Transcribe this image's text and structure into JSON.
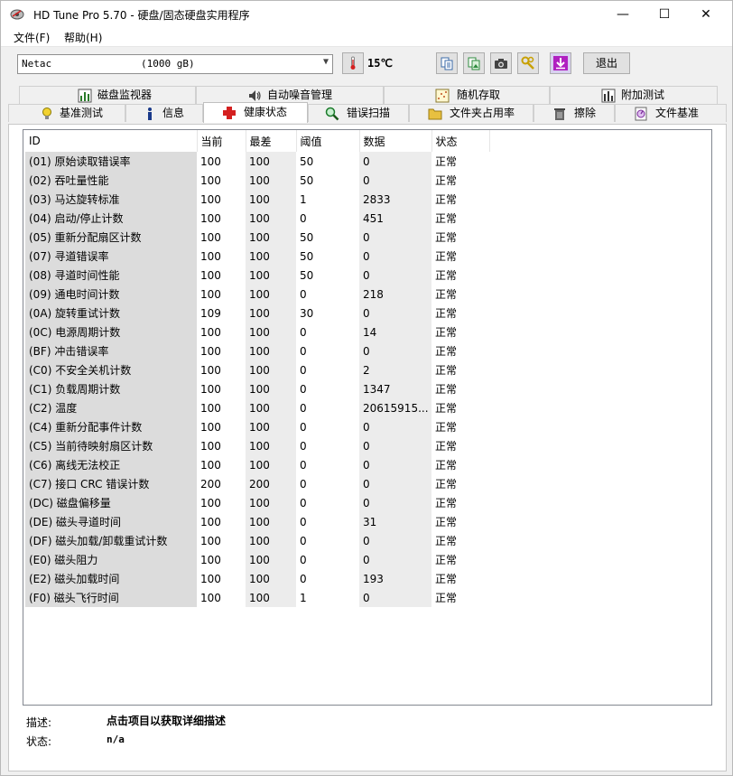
{
  "window": {
    "title": "HD Tune Pro 5.70 - 硬盘/固态硬盘实用程序",
    "minimize": "—",
    "maximize": "☐",
    "close": "✕"
  },
  "menu": {
    "file": "文件(F)",
    "help": "帮助(H)"
  },
  "toolbar": {
    "drive_name": "Netac",
    "drive_capacity": "(1000 gB)",
    "temperature": "15℃",
    "exit_label": "退出"
  },
  "tabs": {
    "row1": [
      "磁盘监视器",
      "自动噪音管理",
      "随机存取",
      "附加测试"
    ],
    "row2": [
      "基准测试",
      "信息",
      "健康状态",
      "错误扫描",
      "文件夹占用率",
      "擦除",
      "文件基准"
    ]
  },
  "smart": {
    "headers": [
      "ID",
      "当前",
      "最差",
      "阈值",
      "数据",
      "状态"
    ],
    "rows": [
      [
        "(01) 原始读取错误率",
        "100",
        "100",
        "50",
        "0",
        "正常"
      ],
      [
        "(02) 吞吐量性能",
        "100",
        "100",
        "50",
        "0",
        "正常"
      ],
      [
        "(03) 马达旋转标准",
        "100",
        "100",
        "1",
        "2833",
        "正常"
      ],
      [
        "(04) 启动/停止计数",
        "100",
        "100",
        "0",
        "451",
        "正常"
      ],
      [
        "(05) 重新分配扇区计数",
        "100",
        "100",
        "50",
        "0",
        "正常"
      ],
      [
        "(07) 寻道错误率",
        "100",
        "100",
        "50",
        "0",
        "正常"
      ],
      [
        "(08) 寻道时间性能",
        "100",
        "100",
        "50",
        "0",
        "正常"
      ],
      [
        "(09) 通电时间计数",
        "100",
        "100",
        "0",
        "218",
        "正常"
      ],
      [
        "(0A) 旋转重试计数",
        "109",
        "100",
        "30",
        "0",
        "正常"
      ],
      [
        "(0C) 电源周期计数",
        "100",
        "100",
        "0",
        "14",
        "正常"
      ],
      [
        "(BF) 冲击错误率",
        "100",
        "100",
        "0",
        "0",
        "正常"
      ],
      [
        "(C0) 不安全关机计数",
        "100",
        "100",
        "0",
        "2",
        "正常"
      ],
      [
        "(C1) 负载周期计数",
        "100",
        "100",
        "0",
        "1347",
        "正常"
      ],
      [
        "(C2) 温度",
        "100",
        "100",
        "0",
        "20615915...",
        "正常"
      ],
      [
        "(C4) 重新分配事件计数",
        "100",
        "100",
        "0",
        "0",
        "正常"
      ],
      [
        "(C5) 当前待映射扇区计数",
        "100",
        "100",
        "0",
        "0",
        "正常"
      ],
      [
        "(C6) 离线无法校正",
        "100",
        "100",
        "0",
        "0",
        "正常"
      ],
      [
        "(C7) 接口 CRC 错误计数",
        "200",
        "200",
        "0",
        "0",
        "正常"
      ],
      [
        "(DC) 磁盘偏移量",
        "100",
        "100",
        "0",
        "0",
        "正常"
      ],
      [
        "(DE) 磁头寻道时间",
        "100",
        "100",
        "0",
        "31",
        "正常"
      ],
      [
        "(DF) 磁头加载/卸载重试计数",
        "100",
        "100",
        "0",
        "0",
        "正常"
      ],
      [
        "(E0) 磁头阻力",
        "100",
        "100",
        "0",
        "0",
        "正常"
      ],
      [
        "(E2) 磁头加载时间",
        "100",
        "100",
        "0",
        "193",
        "正常"
      ],
      [
        "(F0) 磁头飞行时间",
        "100",
        "100",
        "1",
        "0",
        "正常"
      ]
    ]
  },
  "footer": {
    "desc_label": "描述:",
    "desc_text": "点击项目以获取详细描述",
    "status_label": "状态:",
    "status_text": "n/a"
  },
  "colors": {
    "accent_red": "#d42020",
    "id_column_bg": "#dcdcdc",
    "alt_column_bg": "#ececec"
  }
}
